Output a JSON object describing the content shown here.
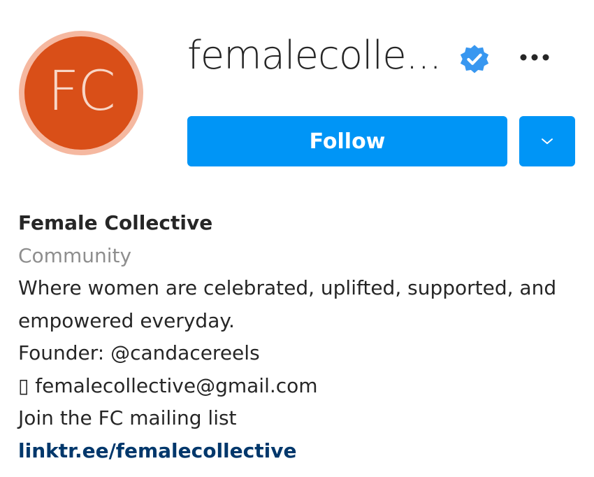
{
  "profile": {
    "avatar_initials": "FC",
    "username": "femalecolle...",
    "verified_icon": "verified-badge-icon",
    "more_icon": "more-options-icon"
  },
  "actions": {
    "follow_label": "Follow",
    "dropdown_icon": "chevron-down-icon"
  },
  "bio": {
    "name": "Female Collective",
    "category": "Community",
    "description_line1": "Where women are celebrated, uplifted, supported, and",
    "description_line2": "empowered everyday.",
    "founder": "Founder: @candacereels",
    "email": "▯ femalecollective@gmail.com",
    "mailing_list": "Join the FC mailing list",
    "link": "linktr.ee/femalecollective"
  },
  "colors": {
    "accent": "#0095f6",
    "avatar_bg": "#d94f18",
    "avatar_ring": "#f5b8a0",
    "verified": "#3897f0",
    "category_text": "#8e8e8e",
    "link_text": "#00376b"
  }
}
